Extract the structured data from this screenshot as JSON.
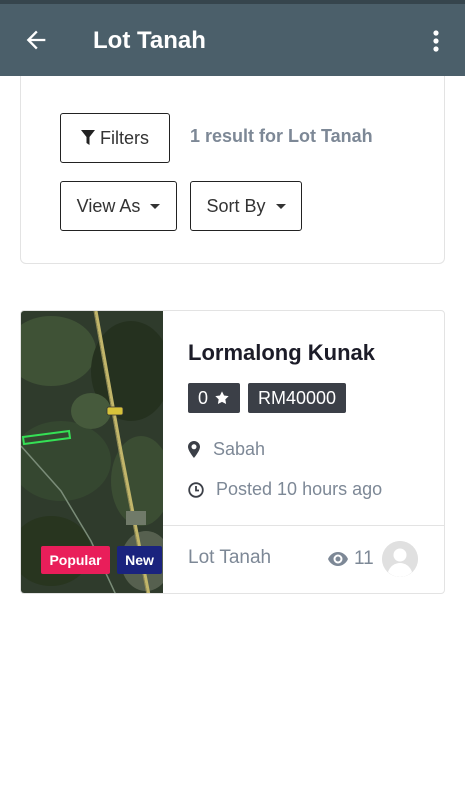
{
  "appbar": {
    "title": "Lot Tanah",
    "back_icon": "arrow-left-icon",
    "menu_icon": "more-vert-icon",
    "background": "#4b5f6a"
  },
  "filters": {
    "filters_label": "Filters",
    "result_text": "1 result for Lot Tanah",
    "view_as_label": "View As",
    "sort_by_label": "Sort By"
  },
  "listing": {
    "title": "Lormalong Kunak",
    "rating": "0",
    "price": "RM40000",
    "location": "Sabah",
    "posted": "Posted 10 hours ago",
    "category": "Lot Tanah",
    "views": "11",
    "badges": [
      "Popular",
      "New"
    ],
    "badge_colors": {
      "popular": "#e91e5a",
      "new": "#1a237e"
    }
  }
}
